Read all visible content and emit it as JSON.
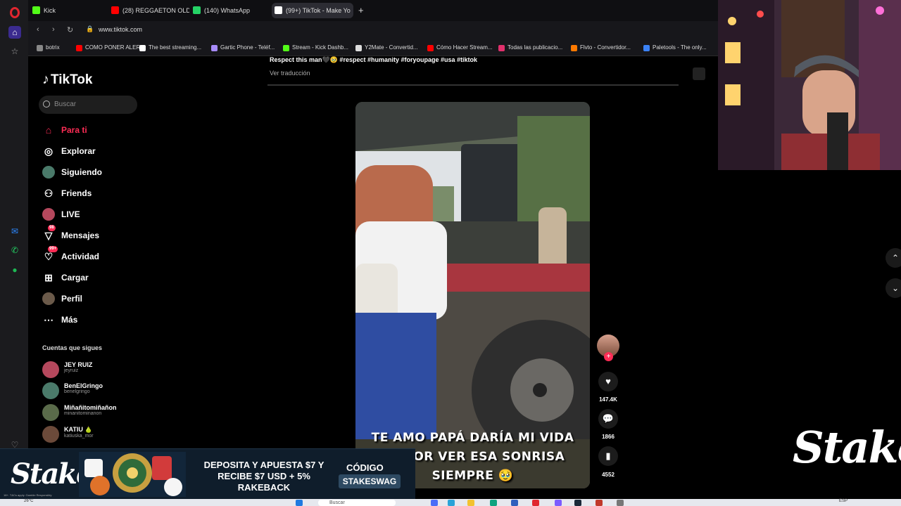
{
  "browser": {
    "tabs": [
      {
        "label": "Kick",
        "color": "#53fc18"
      },
      {
        "label": "(28) REGGAETON OLD SC",
        "color": "#ff0000"
      },
      {
        "label": "(140) WhatsApp",
        "color": "#25d366"
      },
      {
        "label": "(99+) TikTok - Make Yo",
        "color": "#ffffff",
        "active": true
      }
    ],
    "url": "www.tiktok.com",
    "bookmarks": [
      {
        "label": "botrix",
        "color": "#888888"
      },
      {
        "label": "COMO PONER ALER...",
        "color": "#ff0000"
      },
      {
        "label": "The best streaming...",
        "color": "#ffffff"
      },
      {
        "label": "Gartic Phone - Teléf...",
        "color": "#a78bfa"
      },
      {
        "label": "Stream - Kick Dashb...",
        "color": "#53fc18"
      },
      {
        "label": "Y2Mate - Convertid...",
        "color": "#dddddd"
      },
      {
        "label": "Cómo Hacer Stream...",
        "color": "#ff0000"
      },
      {
        "label": "Todas las publicacio...",
        "color": "#e1306c"
      },
      {
        "label": "Flvto - Convertidor...",
        "color": "#ff7a00"
      },
      {
        "label": "Paletools - The only...",
        "color": "#3b82f6"
      }
    ]
  },
  "tiktok": {
    "logo": "TikTok",
    "search_placeholder": "Buscar",
    "nav": [
      {
        "label": "Para ti",
        "icon": "home-icon",
        "glyph": "⌂"
      },
      {
        "label": "Explorar",
        "icon": "compass-icon",
        "glyph": "◎"
      },
      {
        "label": "Siguiendo",
        "icon": "following-avatar-icon",
        "glyph": "●"
      },
      {
        "label": "Friends",
        "icon": "friends-icon",
        "glyph": "⚇"
      },
      {
        "label": "LIVE",
        "icon": "live-icon",
        "glyph": "●"
      },
      {
        "label": "Mensajes",
        "icon": "messages-icon",
        "glyph": "▽",
        "badge": "98"
      },
      {
        "label": "Actividad",
        "icon": "activity-icon",
        "glyph": "♡",
        "badge": "99+"
      },
      {
        "label": "Cargar",
        "icon": "upload-icon",
        "glyph": "⊞"
      },
      {
        "label": "Perfil",
        "icon": "profile-avatar-icon",
        "glyph": "●"
      },
      {
        "label": "Más",
        "icon": "more-icon",
        "glyph": "⋯"
      }
    ],
    "following_title": "Cuentas que sigues",
    "following": [
      {
        "name": "JEY RUIZ",
        "handle": "jeyruiz",
        "color": "#b5485d"
      },
      {
        "name": "BenElGringo",
        "handle": "benelgringo",
        "color": "#4a7a6a"
      },
      {
        "name": "Miñañitomiñañon",
        "handle": "minanitominanon",
        "color": "#5a6b4a"
      },
      {
        "name": "KATIU 🍐",
        "handle": "katiuska_mor",
        "color": "#6b4a3a"
      }
    ],
    "caption": "Respect this man🖤🥹 #respect #humanity #foryoupage #usa #tiktok",
    "translate": "Ver traducción",
    "video_overlay": [
      "TE AMO PAPÁ  DARÍA MI VIDA",
      "RA POR VER ESA SONRISA",
      "SIEMPRE 🥹"
    ],
    "likes": "147.4K",
    "comments": "1866",
    "saves": "4552"
  },
  "stream": {
    "stake_logo": "Stake",
    "banner": {
      "logo": "Stake",
      "promo": "DEPOSITA Y APUESTA $7 Y RECIBE $7 USD + 5% RAKEBACK",
      "code_label": "CÓDIGO",
      "code": "STAKESWAG",
      "disclaimer": "18+. T&Cs apply. Gamble Responsibly"
    }
  },
  "taskbar": {
    "search": "Buscar",
    "lang": "ESP",
    "temp": "26°C"
  }
}
